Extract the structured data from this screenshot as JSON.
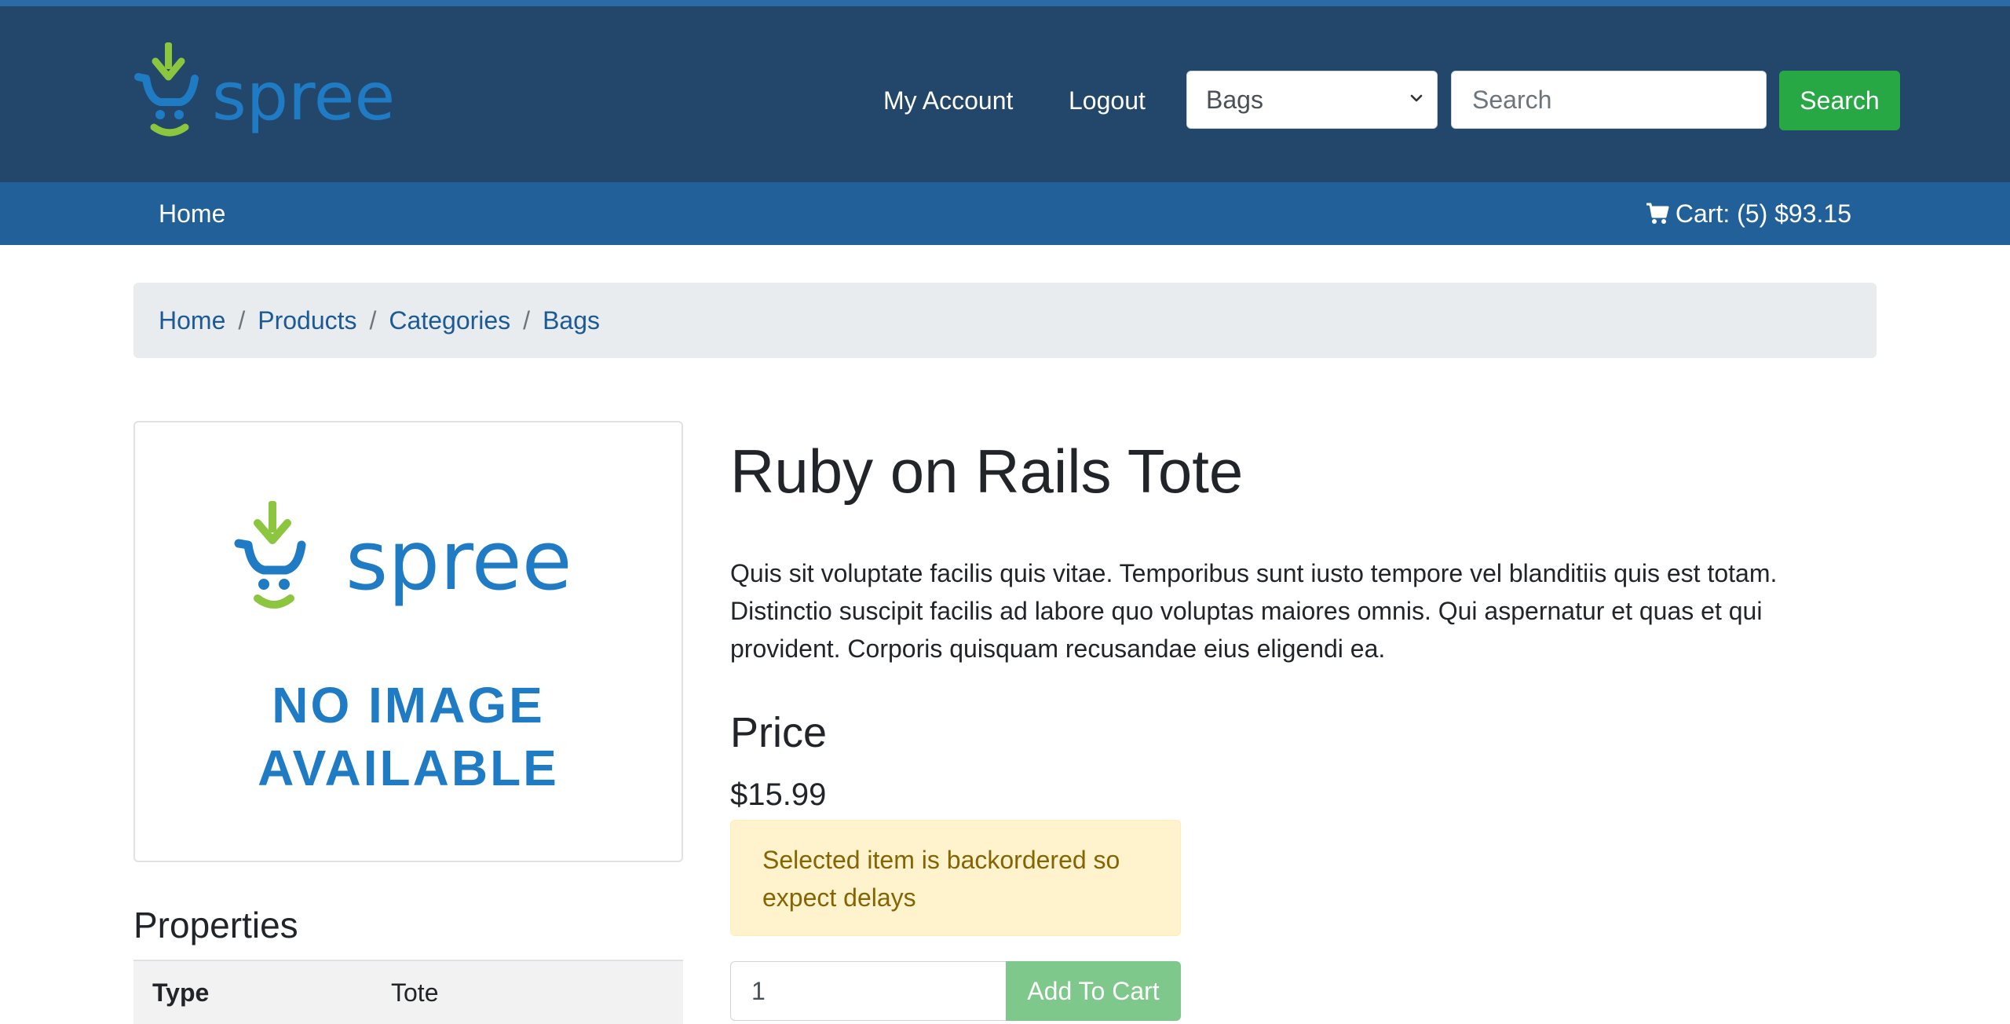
{
  "colors": {
    "header_bg": "#22476b",
    "subnav_bg": "#22609a",
    "accent_green": "#28a745",
    "link_blue": "#1c5a96",
    "alert_bg": "#fff3cd",
    "alert_text": "#856404"
  },
  "header": {
    "logo_text": "spree",
    "my_account": "My Account",
    "logout": "Logout",
    "taxon_select_value": "Bags",
    "search_placeholder": "Search",
    "search_button": "Search"
  },
  "subnav": {
    "home": "Home",
    "cart": "Cart: (5) $93.15",
    "cart_icon": "shopping-cart-icon"
  },
  "breadcrumb": [
    "Home",
    "Products",
    "Categories",
    "Bags"
  ],
  "product": {
    "image_logo_text": "spree",
    "no_image_line1": "NO IMAGE",
    "no_image_line2": "AVAILABLE",
    "title": "Ruby on Rails Tote",
    "description": "Quis sit voluptate facilis quis vitae. Temporibus sunt iusto tempore vel blanditiis quis est totam. Distinctio suscipit facilis ad labore quo voluptas maiores omnis. Qui aspernatur et quas et qui provident. Corporis quisquam recusandae eius eligendi ea.",
    "price_heading": "Price",
    "price": "$15.99",
    "backorder_notice": "Selected item is backordered so expect delays",
    "quantity": "1",
    "add_to_cart": "Add To Cart"
  },
  "properties": {
    "title": "Properties",
    "rows": [
      {
        "key": "Type",
        "value": "Tote"
      }
    ]
  }
}
